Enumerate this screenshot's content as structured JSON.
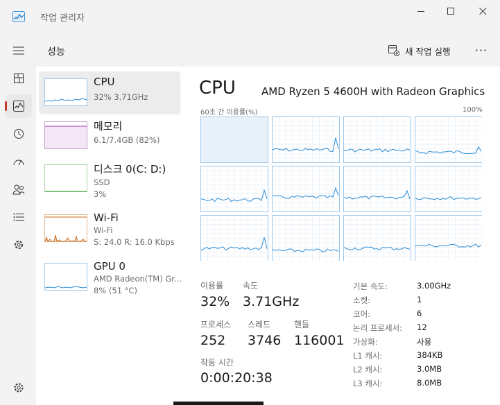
{
  "window": {
    "title": "작업 관리자",
    "controls": [
      "minimize-icon",
      "maximize-icon",
      "close-icon"
    ]
  },
  "rail": {
    "items": [
      {
        "icon": "hamburger-icon"
      },
      {
        "icon": "processes-icon"
      },
      {
        "icon": "performance-icon",
        "active": true
      },
      {
        "icon": "app-history-icon"
      },
      {
        "icon": "startup-apps-icon"
      },
      {
        "icon": "users-icon"
      },
      {
        "icon": "details-icon"
      },
      {
        "icon": "services-icon"
      },
      {
        "icon": "settings-icon"
      }
    ]
  },
  "header": {
    "title": "성능",
    "run_new_task": "새 작업 실행",
    "more": "···"
  },
  "devices": [
    {
      "name": "CPU",
      "line1": "32%  3.71GHz",
      "line2": "",
      "color": "#2a8ad4"
    },
    {
      "name": "메모리",
      "line1": "6.1/7.4GB (82%)",
      "line2": "",
      "color": "#a33bb0"
    },
    {
      "name": "디스크 0(C: D:)",
      "line1": "SSD",
      "line2": "3%",
      "color": "#3d9b3d"
    },
    {
      "name": "Wi-Fi",
      "line1": "Wi-Fi",
      "line2": "S: 24.0  R: 16.0 Kbps",
      "color": "#c86b1e"
    },
    {
      "name": "GPU 0",
      "line1": "AMD Radeon(TM) Gr...",
      "line2": "8%  (51 °C)",
      "color": "#2a8ad4"
    }
  ],
  "cpu": {
    "title": "CPU",
    "model": "AMD Ryzen 5 4600H with Radeon Graphics",
    "chart_left_label": "60초 간 이용률(%)",
    "chart_right_label": "100%",
    "stats": {
      "utilization_label": "이용률",
      "utilization_value": "32%",
      "speed_label": "속도",
      "speed_value": "3.71GHz",
      "processes_label": "프로세스",
      "processes_value": "252",
      "threads_label": "스레드",
      "threads_value": "3746",
      "handles_label": "핸들",
      "handles_value": "116001",
      "uptime_label": "작동 시간",
      "uptime_value": "0:00:20:38"
    },
    "specs": [
      {
        "key": "기본 속도:",
        "value": "3.00GHz"
      },
      {
        "key": "소켓:",
        "value": "1"
      },
      {
        "key": "코어:",
        "value": "6"
      },
      {
        "key": "논리 프로세서:",
        "value": "12"
      },
      {
        "key": "가상화:",
        "value": "사용"
      },
      {
        "key": "L1 캐시:",
        "value": "384KB"
      },
      {
        "key": "L2 캐시:",
        "value": "3.0MB"
      },
      {
        "key": "L3 캐시:",
        "value": "8.0MB"
      }
    ]
  },
  "colors": {
    "accent_cpu": "#2a8ad4",
    "grid": "#e2ecf5",
    "active_indicator": "#c0392b"
  }
}
